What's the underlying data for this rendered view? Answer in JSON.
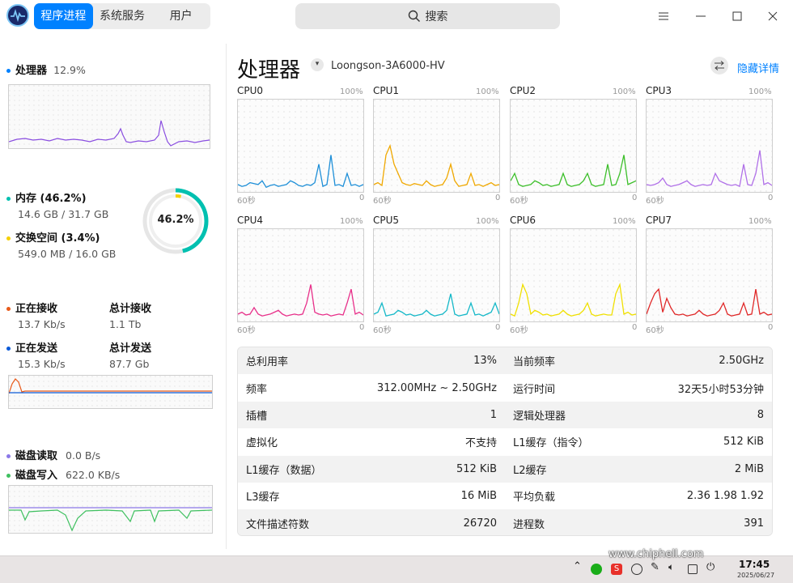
{
  "app": {
    "tabs": [
      "程序进程",
      "系统服务",
      "用户"
    ],
    "active_tab": 0,
    "search_placeholder": "搜索"
  },
  "window_controls": [
    "menu-icon",
    "minimize-icon",
    "maximize-icon",
    "close-icon"
  ],
  "left_panel": {
    "cpu": {
      "label": "处理器",
      "value": "12.9%",
      "color": "#0081ff"
    },
    "memory": {
      "label": "内存 (46.2%)",
      "detail": "14.6 GB / 31.7 GB",
      "color": "#00c0b0"
    },
    "swap": {
      "label": "交换空间 (3.4%)",
      "detail": "549.0 MB / 16.0 GB",
      "color": "#f5d000"
    },
    "ring_text": "46.2%",
    "ring_value": 0.462,
    "swap_ring_value": 0.034,
    "net": {
      "recv_label": "正在接收",
      "recv_value": "13.7 Kb/s",
      "total_recv_label": "总计接收",
      "total_recv_value": "1.1 Tb",
      "send_label": "正在发送",
      "send_value": "15.3 Kb/s",
      "total_send_label": "总计发送",
      "total_send_value": "87.7 Gb",
      "recv_color": "#e85a1a",
      "send_color": "#0a5ad8"
    },
    "disk": {
      "read_label": "磁盘读取",
      "read_value": "0.0 B/s",
      "write_label": "磁盘写入",
      "write_value": "622.0 KB/s",
      "read_color": "#8b78e8",
      "write_color": "#3fc060"
    }
  },
  "right_panel": {
    "title": "处理器",
    "model": "Loongson-3A6000-HV",
    "toggle_label": "隐藏详情",
    "cpus": [
      {
        "name": "CPU0",
        "color": "#1e8fd8"
      },
      {
        "name": "CPU1",
        "color": "#f0a800"
      },
      {
        "name": "CPU2",
        "color": "#3cbf2a"
      },
      {
        "name": "CPU3",
        "color": "#b070e8"
      },
      {
        "name": "CPU4",
        "color": "#e8308a"
      },
      {
        "name": "CPU5",
        "color": "#14b8c8"
      },
      {
        "name": "CPU6",
        "color": "#f0e000"
      },
      {
        "name": "CPU7",
        "color": "#e02828"
      }
    ],
    "pct_label": "100%",
    "axis_left": "60秒",
    "axis_right": "0",
    "details": [
      [
        "总利用率",
        "13%",
        "当前频率",
        "2.50GHz"
      ],
      [
        "频率",
        "312.00MHz ~ 2.50GHz",
        "运行时间",
        "32天5小时53分钟"
      ],
      [
        "插槽",
        "1",
        "逻辑处理器",
        "8"
      ],
      [
        "虚拟化",
        "不支持",
        "L1缓存（指令）",
        "512 KiB"
      ],
      [
        "L1缓存（数据）",
        "512 KiB",
        "L2缓存",
        "2 MiB"
      ],
      [
        "L3缓存",
        "16 MiB",
        "平均负载",
        "2.36 1.98 1.92"
      ],
      [
        "文件描述符数",
        "26720",
        "进程数",
        "391"
      ]
    ]
  },
  "taskbar": {
    "time": "17:45",
    "date": "2025/06/27",
    "watermark": "www.chiphell.com"
  }
}
